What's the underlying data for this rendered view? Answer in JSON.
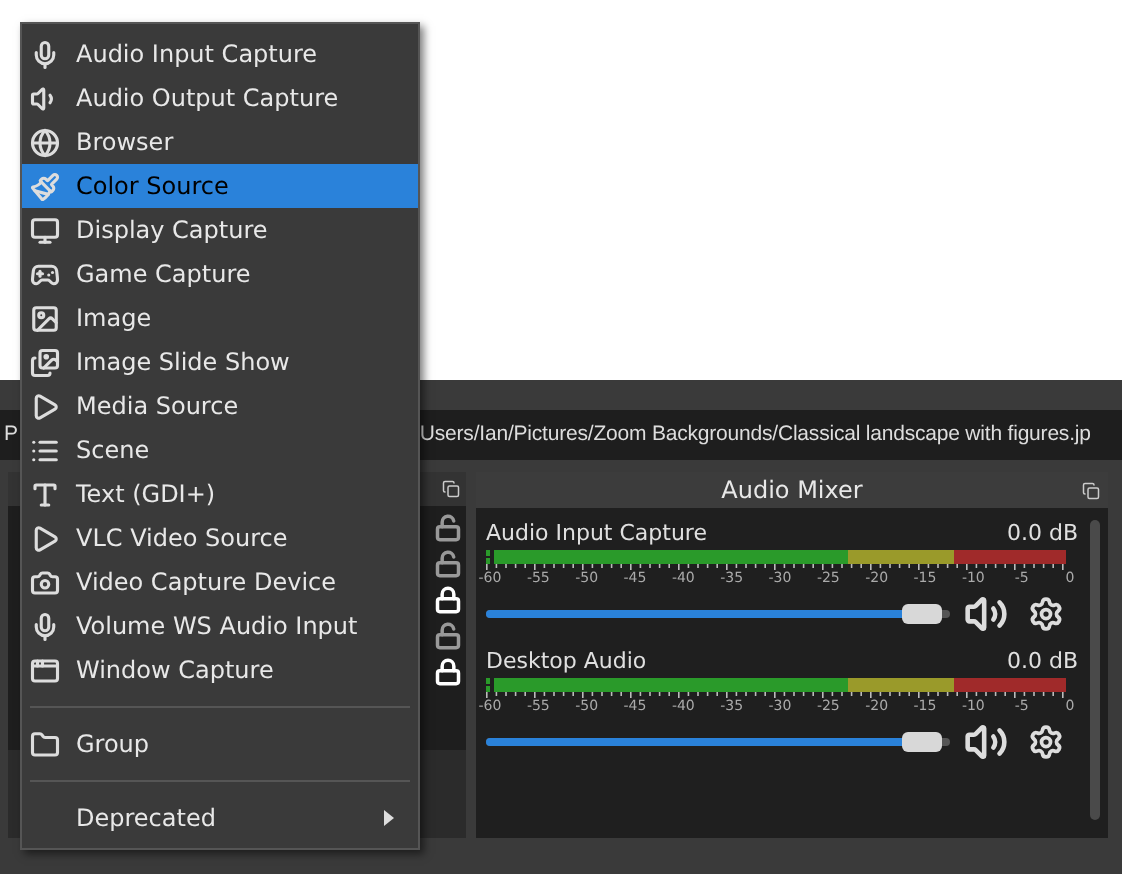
{
  "menu": {
    "items": [
      {
        "kind": "item",
        "label": "Audio Input Capture",
        "selected": false
      },
      {
        "kind": "item",
        "label": "Audio Output Capture",
        "selected": false
      },
      {
        "kind": "item",
        "label": "Browser",
        "selected": false
      },
      {
        "kind": "item",
        "label": "Color Source",
        "selected": true
      },
      {
        "kind": "item",
        "label": "Display Capture",
        "selected": false
      },
      {
        "kind": "item",
        "label": "Game Capture",
        "selected": false
      },
      {
        "kind": "item",
        "label": "Image",
        "selected": false
      },
      {
        "kind": "item",
        "label": "Image Slide Show",
        "selected": false
      },
      {
        "kind": "item",
        "label": "Media Source",
        "selected": false
      },
      {
        "kind": "item",
        "label": "Scene",
        "selected": false
      },
      {
        "kind": "item",
        "label": "Text (GDI+)",
        "selected": false
      },
      {
        "kind": "item",
        "label": "VLC Video Source",
        "selected": false
      },
      {
        "kind": "item",
        "label": "Video Capture Device",
        "selected": false
      },
      {
        "kind": "item",
        "label": "Volume WS Audio Input",
        "selected": false
      },
      {
        "kind": "item",
        "label": "Window Capture",
        "selected": false
      },
      {
        "kind": "separator"
      },
      {
        "kind": "item",
        "label": "Group",
        "selected": false
      },
      {
        "kind": "separator"
      },
      {
        "kind": "submenu",
        "label": "Deprecated",
        "selected": false
      }
    ]
  },
  "path_bar": {
    "label": "P",
    "value": "Users/Ian/Pictures/Zoom Backgrounds/Classical landscape with figures.jp"
  },
  "sources": {
    "locks": [
      {
        "locked": false
      },
      {
        "locked": false
      },
      {
        "locked": true
      },
      {
        "locked": false
      },
      {
        "locked": true
      }
    ]
  },
  "audio_mixer": {
    "title": "Audio Mixer",
    "channels": [
      {
        "name": "Audio Input Capture",
        "reading": "0.0 dB",
        "level": 0.95,
        "scale": [
          "-60",
          "-55",
          "-50",
          "-45",
          "-40",
          "-35",
          "-30",
          "-25",
          "-20",
          "-15",
          "-10",
          "-5",
          "0"
        ]
      },
      {
        "name": "Desktop Audio",
        "reading": "0.0 dB",
        "level": 0.95,
        "scale": [
          "-60",
          "-55",
          "-50",
          "-45",
          "-40",
          "-35",
          "-30",
          "-25",
          "-20",
          "-15",
          "-10",
          "-5",
          "0"
        ]
      }
    ]
  }
}
